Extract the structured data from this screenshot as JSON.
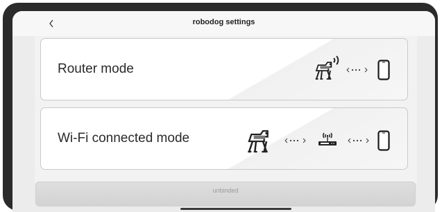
{
  "header": {
    "title": "robodog settings",
    "back_icon": "chevron-left-icon"
  },
  "modes": [
    {
      "label": "Router mode",
      "icons": [
        "robodog-icon",
        "signal-icon",
        "dots-connection-icon",
        "phone-icon"
      ]
    },
    {
      "label": "Wi-Fi connected mode",
      "icons": [
        "robodog-icon",
        "dots-connection-icon",
        "router-icon",
        "dots-connection-icon",
        "phone-icon"
      ]
    }
  ],
  "footer": {
    "button_label": "unbinded"
  },
  "colors": {
    "frame": "#2b2b2b",
    "background": "#ececec",
    "card": "#ffffff",
    "text": "#2a2a2a"
  }
}
